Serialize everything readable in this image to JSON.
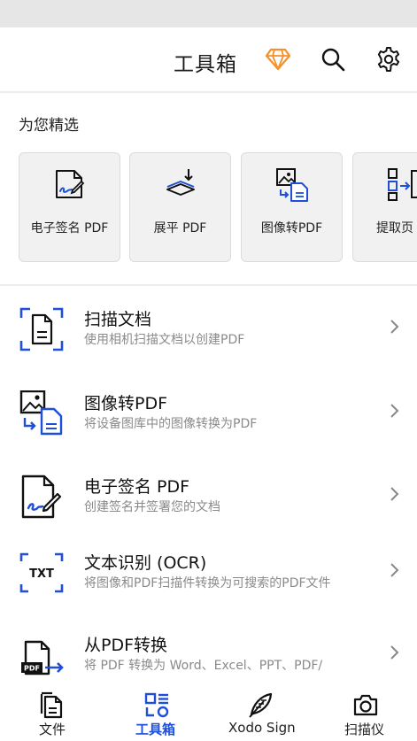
{
  "header": {
    "title": "工具箱",
    "icons": [
      "diamond-icon",
      "search-icon",
      "gear-icon"
    ]
  },
  "featured": {
    "section_title": "为您精选",
    "cards": [
      {
        "label": "电子签名 PDF",
        "icon": "signature-doc-icon"
      },
      {
        "label": "展平 PDF",
        "icon": "flatten-icon"
      },
      {
        "label": "图像转PDF",
        "icon": "image-to-pdf-icon"
      },
      {
        "label": "提取页",
        "icon": "extract-pages-icon"
      }
    ]
  },
  "tools": [
    {
      "title": "扫描文档",
      "subtitle": "使用相机扫描文档以创建PDF",
      "icon": "scan-document-icon"
    },
    {
      "title": "图像转PDF",
      "subtitle": "将设备图库中的图像转换为PDF",
      "icon": "image-to-pdf-icon"
    },
    {
      "title": "电子签名 PDF",
      "subtitle": "创建签名并签署您的文档",
      "icon": "signature-doc-icon"
    },
    {
      "title": "文本识别 (OCR)",
      "subtitle": "将图像和PDF扫描件转换为可搜索的PDF文件",
      "icon": "ocr-icon"
    },
    {
      "title": "从PDF转换",
      "subtitle": "将 PDF 转换为 Word、Excel、PPT、PDF/",
      "icon": "pdf-convert-icon"
    }
  ],
  "bottom_nav": [
    {
      "label": "文件",
      "icon": "files-icon",
      "active": false
    },
    {
      "label": "工具箱",
      "icon": "toolbox-icon",
      "active": true
    },
    {
      "label": "Xodo Sign",
      "icon": "feather-pen-icon",
      "active": false
    },
    {
      "label": "扫描仪",
      "icon": "camera-icon",
      "active": false
    }
  ],
  "colors": {
    "accent": "#1f4fd8",
    "diamond": "#f5902a",
    "muted_text": "#8a8a8a"
  }
}
